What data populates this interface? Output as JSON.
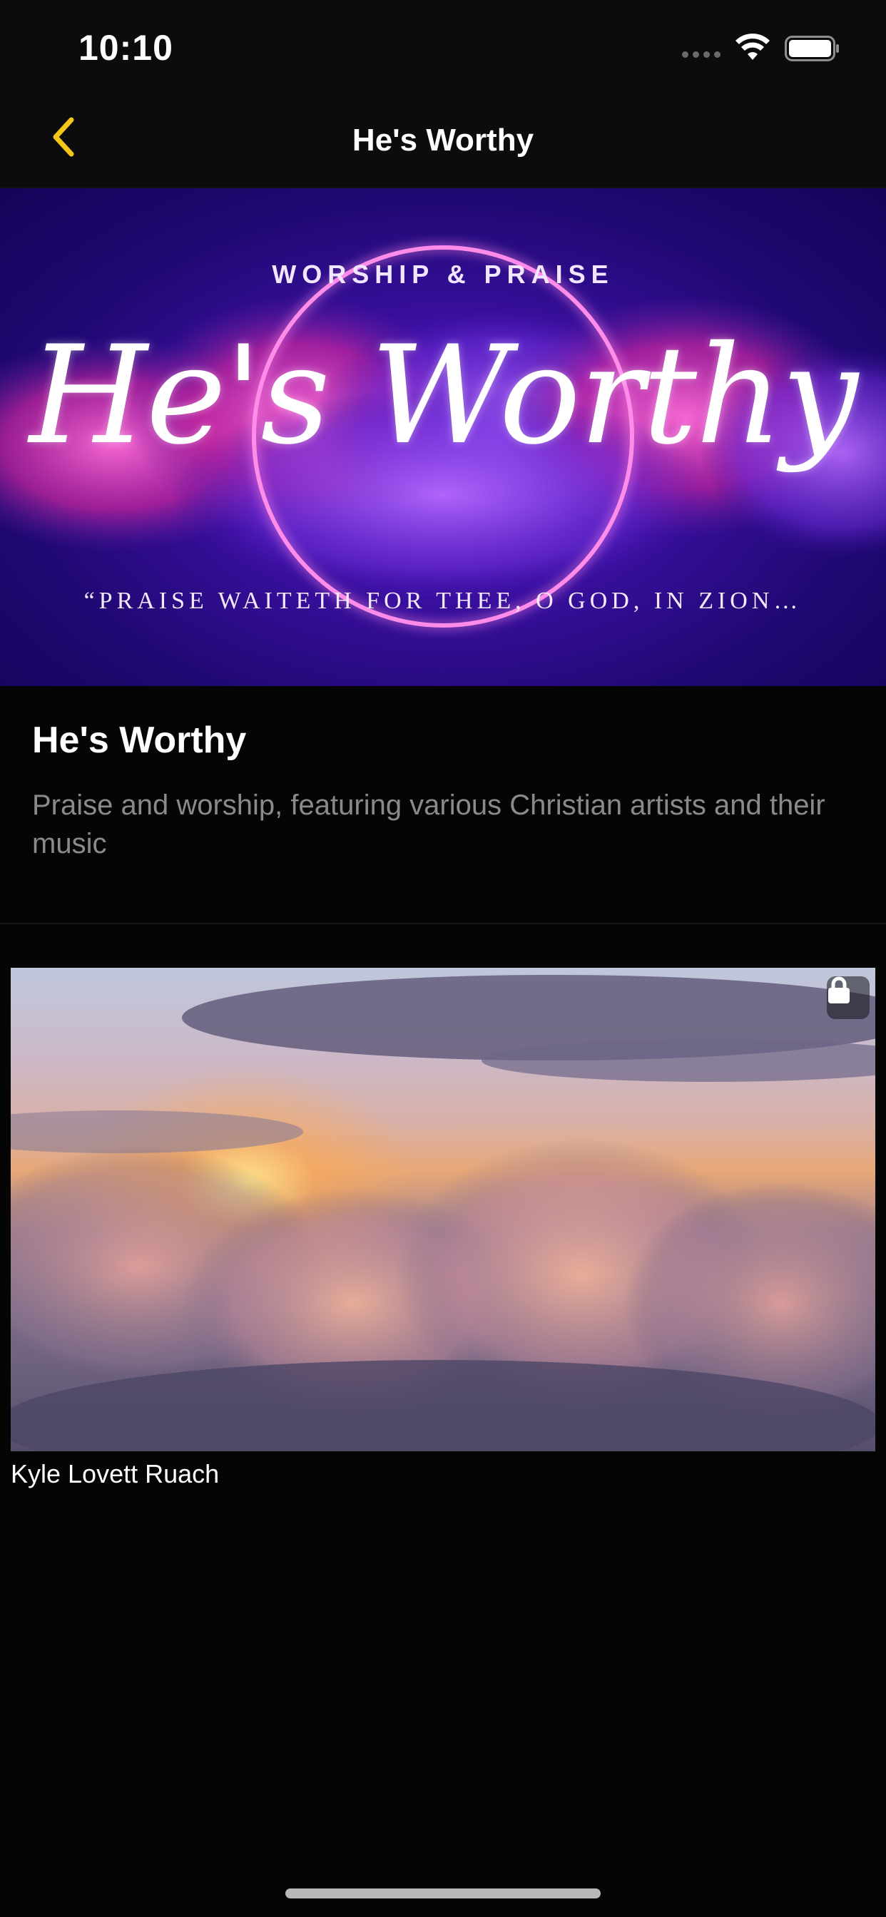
{
  "status_bar": {
    "time": "10:10"
  },
  "nav": {
    "title": "He's Worthy",
    "back_icon": "chevron-left-icon",
    "accent_color": "#f5c518"
  },
  "hero": {
    "overline": "WORSHIP & PRAISE",
    "script_title": "He's Worthy",
    "quote": "“PRAISE WAITETH FOR THEE, O GOD, IN ZION…"
  },
  "info": {
    "title": "He's Worthy",
    "description": "Praise and worship, featuring various Christian artists and their music"
  },
  "videos": [
    {
      "caption": "Kyle Lovett Ruach",
      "locked": true,
      "lock_icon": "lock-icon"
    }
  ]
}
